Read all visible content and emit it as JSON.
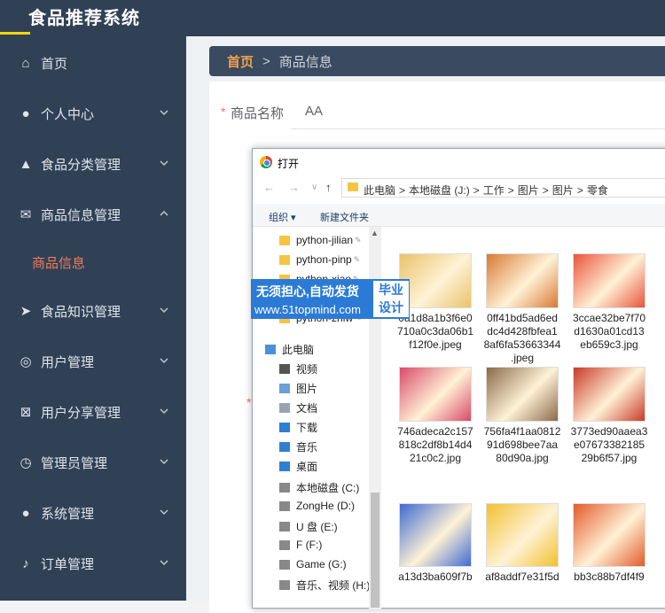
{
  "app": {
    "title": "食品推荐系统"
  },
  "sidebar": {
    "items": [
      {
        "label": "首页",
        "icon": "home-icon",
        "has_chevron": false
      },
      {
        "label": "个人中心",
        "icon": "user-icon",
        "has_chevron": true
      },
      {
        "label": "食品分类管理",
        "icon": "chart-icon",
        "has_chevron": true
      },
      {
        "label": "商品信息管理",
        "icon": "mail-icon",
        "has_chevron": true,
        "expanded": true
      },
      {
        "label": "食品知识管理",
        "icon": "send-icon",
        "has_chevron": true
      },
      {
        "label": "用户管理",
        "icon": "lifebuoy-icon",
        "has_chevron": true
      },
      {
        "label": "用户分享管理",
        "icon": "delete-box-icon",
        "has_chevron": true
      },
      {
        "label": "管理员管理",
        "icon": "clock-icon",
        "has_chevron": true
      },
      {
        "label": "系统管理",
        "icon": "user-icon",
        "has_chevron": true
      },
      {
        "label": "订单管理",
        "icon": "microphone-icon",
        "has_chevron": true
      }
    ],
    "sub_item": "商品信息"
  },
  "breadcrumb": {
    "home": "首页",
    "separator": ">",
    "current": "商品信息"
  },
  "form": {
    "name_label": "商品名称",
    "name_value": "AA",
    "required_mark": "*"
  },
  "dialog": {
    "title": "打开",
    "path": [
      "此电脑",
      ">",
      "本地磁盘 (J:)",
      ">",
      "工作",
      ">",
      "图片",
      ">",
      "图片",
      ">",
      "零食"
    ],
    "organize": "组织 ▾",
    "new_folder": "新建文件夹",
    "tree": [
      {
        "label": "python-jilian",
        "type": "folder"
      },
      {
        "label": "python-pinp",
        "type": "folder"
      },
      {
        "label": "python-xiao",
        "type": "folder"
      },
      {
        "label": "python-zhiw",
        "type": "folder"
      },
      {
        "label": "此电脑",
        "type": "pc"
      },
      {
        "label": "视频",
        "type": "video"
      },
      {
        "label": "图片",
        "type": "image"
      },
      {
        "label": "文档",
        "type": "doc"
      },
      {
        "label": "下载",
        "type": "download"
      },
      {
        "label": "音乐",
        "type": "music"
      },
      {
        "label": "桌面",
        "type": "desktop"
      },
      {
        "label": "本地磁盘 (C:)",
        "type": "drive"
      },
      {
        "label": "ZongHe (D:)",
        "type": "drive"
      },
      {
        "label": "U 盘 (E:)",
        "type": "drive"
      },
      {
        "label": "F (F:)",
        "type": "drive"
      },
      {
        "label": "Game (G:)",
        "type": "drive"
      },
      {
        "label": "音乐、视频 (H:)",
        "type": "drive"
      }
    ],
    "files": [
      {
        "name": "0a1d8a1b3f6e0710a0c3da06b1f12f0e.jpeg",
        "lines": [
          "0a1d8a1b3f6e0",
          "710a0c3da06b1",
          "f12f0e.jpeg"
        ],
        "color": "#e9c36a"
      },
      {
        "name": "0ff41bd5ad6eddc4d428fbfea18af6fa53663344.jpeg",
        "lines": [
          "0ff41bd5ad6ed",
          "dc4d428fbfea1",
          "8af6fa53663344",
          ".jpeg"
        ],
        "color": "#d97a35"
      },
      {
        "name": "3ccae32be7f70d1630a01cd13eb659c3.jpg",
        "lines": [
          "3ccae32be7f70",
          "d1630a01cd13",
          "eb659c3.jpg"
        ],
        "color": "#e8543c"
      },
      {
        "name": "746adeca2c157818c2df8b14d421c0c2.jpg",
        "lines": [
          "746adeca2c157",
          "818c2df8b14d4",
          "21c0c2.jpg"
        ],
        "color": "#d84b6a"
      },
      {
        "name": "756fa4f1aa081291d698bee7aa80d90a.jpg",
        "lines": [
          "756fa4f1aa0812",
          "91d698bee7aa",
          "80d90a.jpg"
        ],
        "color": "#8a6a4a"
      },
      {
        "name": "3773ed90aaea3e07673382185 29b6f57.jpg",
        "lines": [
          "3773ed90aaea3",
          "e07673382185",
          "29b6f57.jpg"
        ],
        "color": "#c83a2a"
      },
      {
        "name": "a13d3ba609f7b",
        "lines": [
          "a13d3ba609f7b"
        ],
        "color": "#3d6bd1"
      },
      {
        "name": "af8addf7e31f5d",
        "lines": [
          "af8addf7e31f5d"
        ],
        "color": "#f2c12e"
      },
      {
        "name": "bb3c88b7df4f9",
        "lines": [
          "bb3c88b7df4f9"
        ],
        "color": "#e25b2b"
      }
    ]
  },
  "watermark": {
    "line1": "无须担心,自动发货",
    "line2": "www.51topmind.com",
    "side": "毕业设计"
  }
}
